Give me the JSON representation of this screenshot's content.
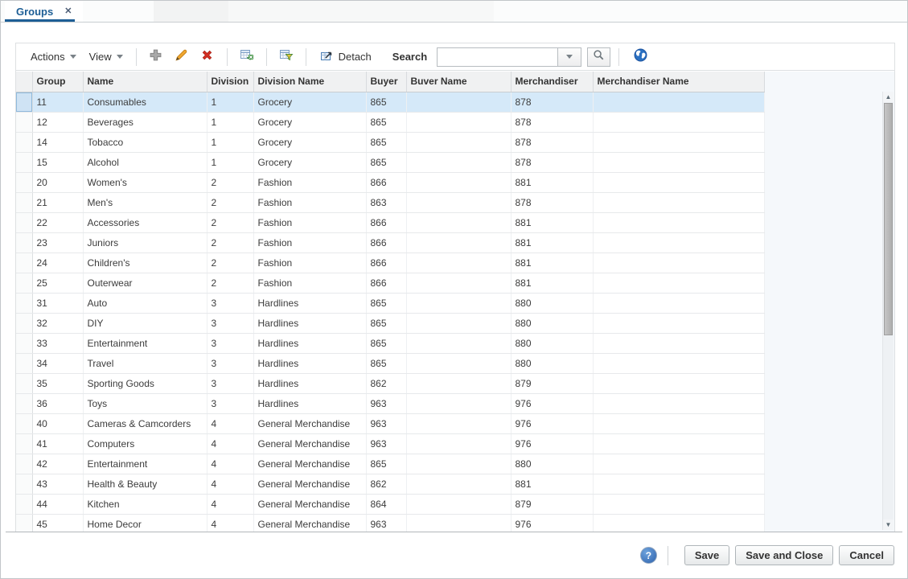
{
  "tab_bar": {
    "active_tab": "Groups",
    "close_icon": "✕"
  },
  "toolbar": {
    "actions": "Actions",
    "view": "View",
    "detach": "Detach",
    "search_label": "Search",
    "search_value": "",
    "search_placeholder": ""
  },
  "table": {
    "columns": [
      "Group",
      "Name",
      "Division",
      "Division Name",
      "Buyer",
      "Buver Name",
      "Merchandiser",
      "Merchandiser Name"
    ],
    "selected_row_index": 0,
    "rows": [
      {
        "group": "11",
        "name": "Consumables",
        "division": "1",
        "division_name": "Grocery",
        "buyer": "865",
        "buyer_name": "",
        "merchandiser": "878",
        "merchandiser_name": ""
      },
      {
        "group": "12",
        "name": "Beverages",
        "division": "1",
        "division_name": "Grocery",
        "buyer": "865",
        "buyer_name": "",
        "merchandiser": "878",
        "merchandiser_name": ""
      },
      {
        "group": "14",
        "name": "Tobacco",
        "division": "1",
        "division_name": "Grocery",
        "buyer": "865",
        "buyer_name": "",
        "merchandiser": "878",
        "merchandiser_name": ""
      },
      {
        "group": "15",
        "name": "Alcohol",
        "division": "1",
        "division_name": "Grocery",
        "buyer": "865",
        "buyer_name": "",
        "merchandiser": "878",
        "merchandiser_name": ""
      },
      {
        "group": "20",
        "name": "Women's",
        "division": "2",
        "division_name": "Fashion",
        "buyer": "866",
        "buyer_name": "",
        "merchandiser": "881",
        "merchandiser_name": ""
      },
      {
        "group": "21",
        "name": "Men's",
        "division": "2",
        "division_name": "Fashion",
        "buyer": "863",
        "buyer_name": "",
        "merchandiser": "878",
        "merchandiser_name": ""
      },
      {
        "group": "22",
        "name": "Accessories",
        "division": "2",
        "division_name": "Fashion",
        "buyer": "866",
        "buyer_name": "",
        "merchandiser": "881",
        "merchandiser_name": ""
      },
      {
        "group": "23",
        "name": "Juniors",
        "division": "2",
        "division_name": "Fashion",
        "buyer": "866",
        "buyer_name": "",
        "merchandiser": "881",
        "merchandiser_name": ""
      },
      {
        "group": "24",
        "name": "Children's",
        "division": "2",
        "division_name": "Fashion",
        "buyer": "866",
        "buyer_name": "",
        "merchandiser": "881",
        "merchandiser_name": ""
      },
      {
        "group": "25",
        "name": "Outerwear",
        "division": "2",
        "division_name": "Fashion",
        "buyer": "866",
        "buyer_name": "",
        "merchandiser": "881",
        "merchandiser_name": ""
      },
      {
        "group": "31",
        "name": "Auto",
        "division": "3",
        "division_name": "Hardlines",
        "buyer": "865",
        "buyer_name": "",
        "merchandiser": "880",
        "merchandiser_name": ""
      },
      {
        "group": "32",
        "name": "DIY",
        "division": "3",
        "division_name": "Hardlines",
        "buyer": "865",
        "buyer_name": "",
        "merchandiser": "880",
        "merchandiser_name": ""
      },
      {
        "group": "33",
        "name": "Entertainment",
        "division": "3",
        "division_name": "Hardlines",
        "buyer": "865",
        "buyer_name": "",
        "merchandiser": "880",
        "merchandiser_name": ""
      },
      {
        "group": "34",
        "name": "Travel",
        "division": "3",
        "division_name": "Hardlines",
        "buyer": "865",
        "buyer_name": "",
        "merchandiser": "880",
        "merchandiser_name": ""
      },
      {
        "group": "35",
        "name": "Sporting Goods",
        "division": "3",
        "division_name": "Hardlines",
        "buyer": "862",
        "buyer_name": "",
        "merchandiser": "879",
        "merchandiser_name": ""
      },
      {
        "group": "36",
        "name": "Toys",
        "division": "3",
        "division_name": "Hardlines",
        "buyer": "963",
        "buyer_name": "",
        "merchandiser": "976",
        "merchandiser_name": ""
      },
      {
        "group": "40",
        "name": "Cameras & Camcorders",
        "division": "4",
        "division_name": "General Merchandise",
        "buyer": "963",
        "buyer_name": "",
        "merchandiser": "976",
        "merchandiser_name": ""
      },
      {
        "group": "41",
        "name": "Computers",
        "division": "4",
        "division_name": "General Merchandise",
        "buyer": "963",
        "buyer_name": "",
        "merchandiser": "976",
        "merchandiser_name": ""
      },
      {
        "group": "42",
        "name": "Entertainment",
        "division": "4",
        "division_name": "General Merchandise",
        "buyer": "865",
        "buyer_name": "",
        "merchandiser": "880",
        "merchandiser_name": ""
      },
      {
        "group": "43",
        "name": "Health & Beauty",
        "division": "4",
        "division_name": "General Merchandise",
        "buyer": "862",
        "buyer_name": "",
        "merchandiser": "881",
        "merchandiser_name": ""
      },
      {
        "group": "44",
        "name": "Kitchen",
        "division": "4",
        "division_name": "General Merchandise",
        "buyer": "864",
        "buyer_name": "",
        "merchandiser": "879",
        "merchandiser_name": ""
      },
      {
        "group": "45",
        "name": "Home Decor",
        "division": "4",
        "division_name": "General Merchandise",
        "buyer": "963",
        "buyer_name": "",
        "merchandiser": "976",
        "merchandiser_name": ""
      }
    ]
  },
  "footer": {
    "help_icon": "?",
    "save": "Save",
    "save_and_close": "Save and Close",
    "cancel": "Cancel"
  },
  "colors": {
    "accent_blue": "#1d5e95",
    "selected_row": "#d5e9f9",
    "edit_orange": "#f0a62f",
    "delete_red": "#d32f23",
    "globe_blue": "#2a70c2",
    "help_blue": "#2f63ad",
    "header_bg": "#f0f1f2"
  }
}
